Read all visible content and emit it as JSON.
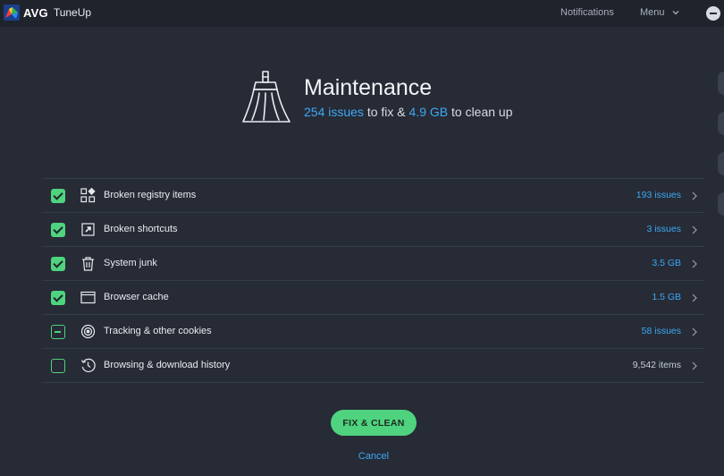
{
  "titlebar": {
    "brand": "AVG",
    "app_name": "TuneUp",
    "notifications_label": "Notifications",
    "menu_label": "Menu"
  },
  "hero": {
    "title": "Maintenance",
    "issues_count": "254 issues",
    "mid_text": " to fix & ",
    "size": "4.9 GB",
    "tail_text": " to clean up"
  },
  "items": [
    {
      "label": "Broken registry items",
      "value": "193 issues",
      "state": "checked",
      "icon": "registry-icon"
    },
    {
      "label": "Broken shortcuts",
      "value": "3 issues",
      "state": "checked",
      "icon": "shortcut-icon"
    },
    {
      "label": "System junk",
      "value": "3.5 GB",
      "state": "checked",
      "icon": "trash-icon"
    },
    {
      "label": "Browser cache",
      "value": "1.5 GB",
      "state": "checked",
      "icon": "browser-window-icon"
    },
    {
      "label": "Tracking & other cookies",
      "value": "58 issues",
      "state": "partial",
      "icon": "target-icon"
    },
    {
      "label": "Browsing & download history",
      "value": "9,542 items",
      "state": "unchecked",
      "icon": "history-clock-icon"
    }
  ],
  "actions": {
    "fix_label": "FIX & CLEAN",
    "cancel_label": "Cancel"
  },
  "colors": {
    "background": "#262b36",
    "titlebar": "#1f232c",
    "accent_green": "#4fd37e",
    "accent_blue": "#3ea8f4"
  }
}
